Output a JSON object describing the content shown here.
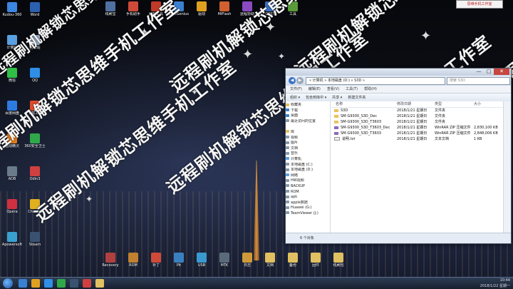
{
  "watermark": "远程刷机解锁芯思维手机工作室",
  "corner_brand": "思维手机工作室",
  "desktop_icons": [
    {
      "label": "Kudou-360",
      "color": "#3b86e0"
    },
    {
      "label": "Word",
      "color": "#2b5fb0"
    },
    {
      "label": "计算机",
      "color": "#5aa0e0"
    },
    {
      "label": "回收站",
      "color": "#9ab0c8"
    },
    {
      "label": "微信",
      "color": "#2fbf47"
    },
    {
      "label": "QQ",
      "color": "#2f8fe6"
    },
    {
      "label": "百度网盘",
      "color": "#2d7be0"
    },
    {
      "label": "下载工具",
      "color": "#e04a2a"
    },
    {
      "label": "驱动精灵",
      "color": "#e07a1a"
    },
    {
      "label": "360安全卫士",
      "color": "#2fa84a"
    },
    {
      "label": "ADB",
      "color": "#6b7b8c"
    },
    {
      "label": "Odin3",
      "color": "#d04040"
    },
    {
      "label": "Opera",
      "color": "#d03040"
    },
    {
      "label": "Chrome",
      "color": "#e0b020"
    },
    {
      "label": "Apowersoft",
      "color": "#3aa0d0"
    },
    {
      "label": "Steam",
      "color": "#3a5270"
    }
  ],
  "top_icons": [
    {
      "label": "线刷宝",
      "color": "#5070a0"
    },
    {
      "label": "手机助手",
      "color": "#d04a3a"
    },
    {
      "label": "刷机工具",
      "color": "#c03a2a"
    },
    {
      "label": "DiscGenius",
      "color": "#3a80d0"
    },
    {
      "label": "驱动",
      "color": "#e0a020"
    },
    {
      "label": "MiFlash",
      "color": "#d06030"
    },
    {
      "label": "远程协助",
      "color": "#8a4ac0"
    },
    {
      "label": "QPST",
      "color": "#3a70c0"
    },
    {
      "label": "工具",
      "color": "#5a9a3a"
    }
  ],
  "bottom_icons": [
    {
      "label": "Recovery",
      "color": "#b04040"
    },
    {
      "label": "ROM",
      "color": "#c08030"
    },
    {
      "label": "补丁",
      "color": "#d04a3a"
    },
    {
      "label": "Pit",
      "color": "#3a80c0"
    },
    {
      "label": "USB",
      "color": "#3a9ad0"
    },
    {
      "label": "MTK",
      "color": "#5a6a7a"
    },
    {
      "label": "日志",
      "color": "#d09a3a"
    },
    {
      "label": "文档",
      "color": "#e0c060"
    },
    {
      "label": "备份",
      "color": "#e0c060"
    },
    {
      "label": "固件",
      "color": "#e0c060"
    },
    {
      "label": "线刷包",
      "color": "#e0c060"
    }
  ],
  "explorer": {
    "path": "« 计算机 » 本地磁盘 (D:) » S3D »",
    "search_placeholder": "搜索 S3D",
    "buttons": {
      "minimize": "—",
      "maximize": "□",
      "close": "✕",
      "back": "◀",
      "forward": "▶"
    },
    "menu": [
      "文件(F)",
      "编辑(E)",
      "查看(V)",
      "工具(T)",
      "帮助(H)"
    ],
    "toolbar": [
      "组织 ▾",
      "包含到库中 ▾",
      "共享 ▾",
      "新建文件夹"
    ],
    "columns": [
      "名称",
      "修改日期",
      "类型",
      "大小"
    ],
    "nav_items": [
      {
        "label": "收藏夹",
        "color": "#e0c060"
      },
      {
        "label": "下载",
        "color": "#3a80d0"
      },
      {
        "label": "桌面",
        "color": "#3a80d0"
      },
      {
        "label": "最近访问的位置",
        "color": "#8899aa"
      },
      {
        "label": "",
        "color": "#ffffff"
      },
      {
        "label": "库",
        "color": "#e0c060"
      },
      {
        "label": "视频",
        "color": "#8899aa"
      },
      {
        "label": "图片",
        "color": "#8899aa"
      },
      {
        "label": "文档",
        "color": "#8899aa"
      },
      {
        "label": "音乐",
        "color": "#8899aa"
      },
      {
        "label": "计算机",
        "color": "#5aa0e0"
      },
      {
        "label": "本地磁盘 (C:)",
        "color": "#8899aa"
      },
      {
        "label": "本地磁盘 (D:)",
        "color": "#8899aa"
      },
      {
        "label": "网络",
        "color": "#5aa0e0"
      },
      {
        "label": "HW视频",
        "color": "#8899aa"
      },
      {
        "label": "BACKUP",
        "color": "#8899aa"
      },
      {
        "label": "ROM",
        "color": "#8899aa"
      },
      {
        "label": "apk",
        "color": "#8899aa"
      },
      {
        "label": "apple数据",
        "color": "#8899aa"
      },
      {
        "label": "Huawei (G:)",
        "color": "#8899aa"
      },
      {
        "label": "TeamViewer (J:)",
        "color": "#8899aa"
      }
    ],
    "files": [
      {
        "name": "S3D",
        "date": "2018/1/21 星期日",
        "type": "文件夹",
        "size": "",
        "kind": "fold"
      },
      {
        "name": "SM-G9300_S3D_Dec",
        "date": "2018/1/21 星期日",
        "type": "文件夹",
        "size": "",
        "kind": "fold"
      },
      {
        "name": "SM-G9300_S3D_T3603",
        "date": "2018/1/21 星期日",
        "type": "文件夹",
        "size": "",
        "kind": "fold"
      },
      {
        "name": "SM-G9300_S3D_T3603_Dec",
        "date": "2018/1/21 星期日",
        "type": "WinRAR ZIP 压缩文件",
        "size": "2,830,100 KB",
        "kind": "zip"
      },
      {
        "name": "SM-G9300_S3D_T3603",
        "date": "2018/1/21 星期日",
        "type": "WinRAR ZIP 压缩文件",
        "size": "2,848,006 KB",
        "kind": "zip"
      },
      {
        "name": "说明.txt",
        "date": "2018/1/21 星期日",
        "type": "文本文档",
        "size": "1 KB",
        "kind": "txt"
      }
    ],
    "status": "6 个对象"
  },
  "taskbar": {
    "time": "10:44",
    "date": "2018/1/22 星期一",
    "items": [
      "#3a80d0",
      "#e0a020",
      "#2f8fe6",
      "#2fa84a",
      "#3a5270",
      "#d04040",
      "#e0c060"
    ]
  }
}
